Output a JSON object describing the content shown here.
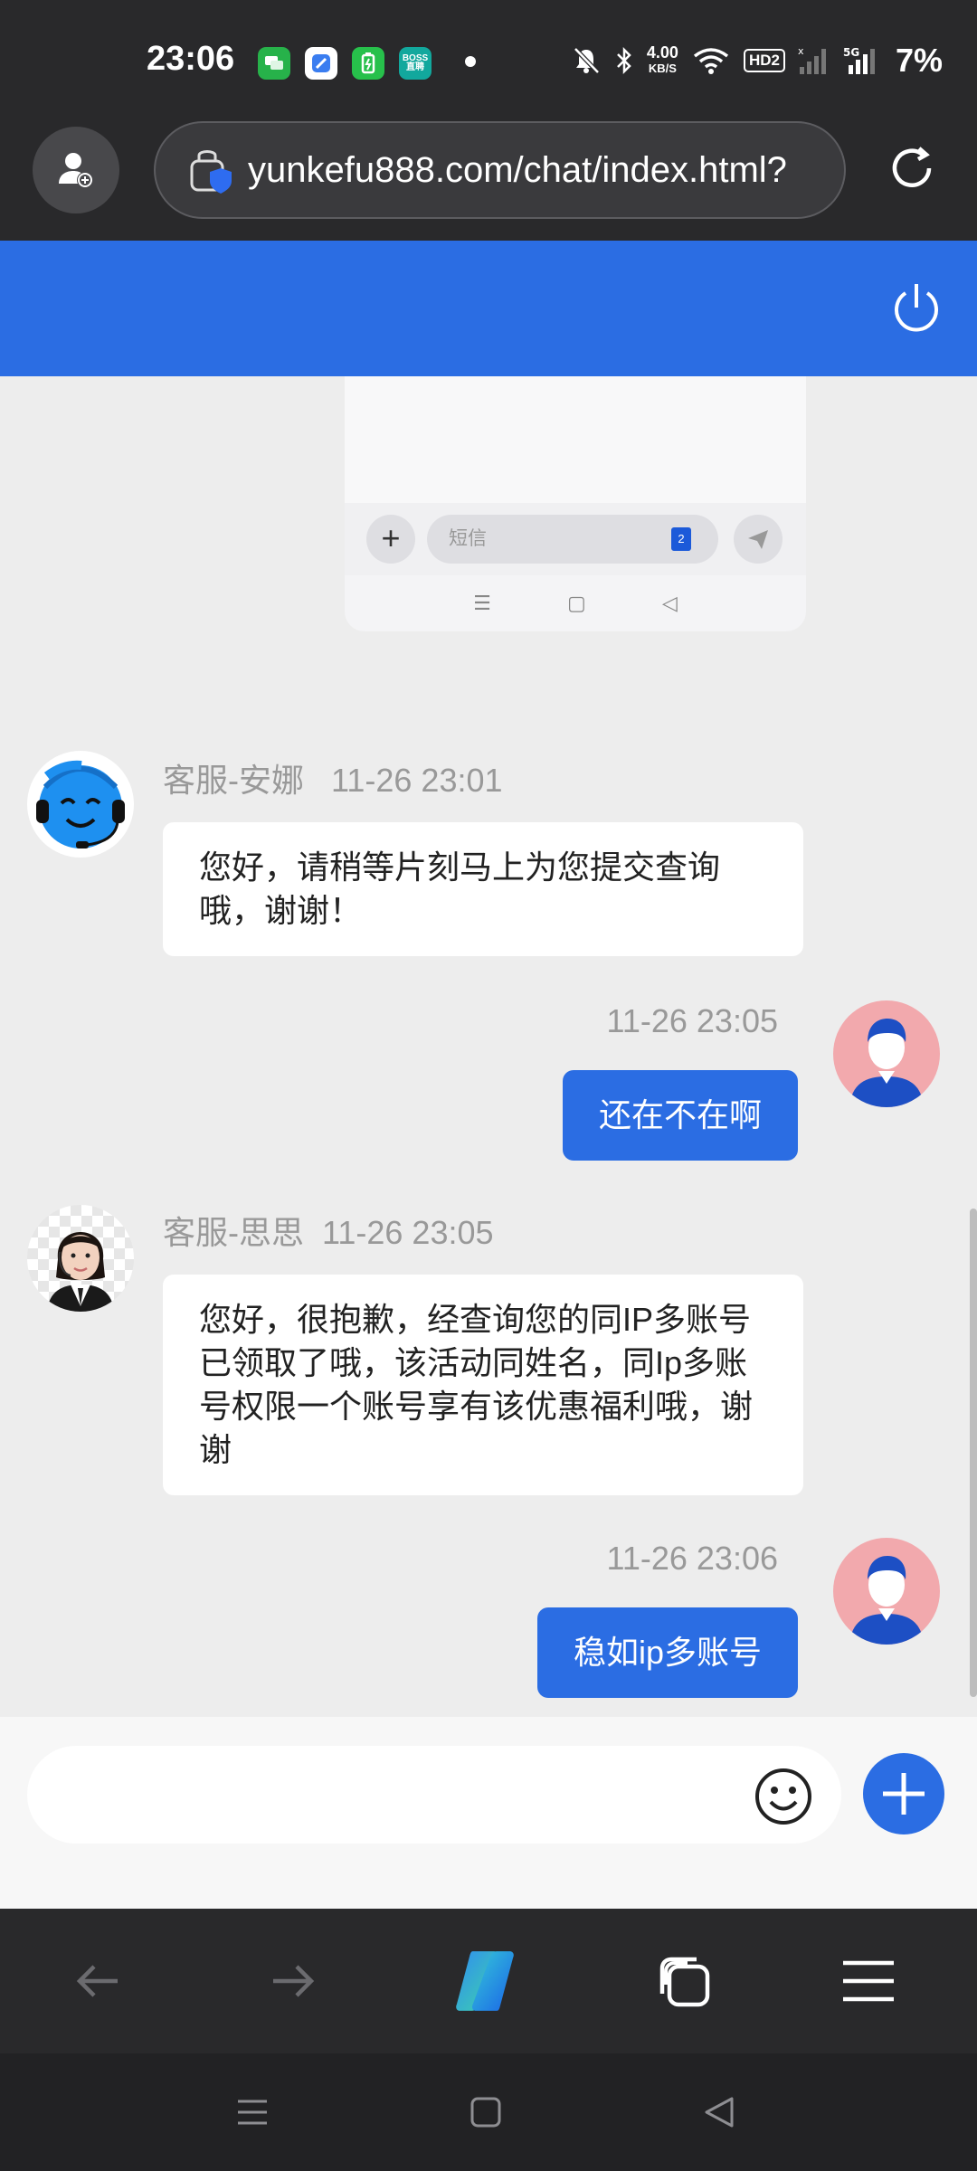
{
  "status_bar": {
    "time": "23:06",
    "net_speed_value": "4.00",
    "net_speed_unit": "KB/S",
    "hd_label": "HD2",
    "network_label": "5G",
    "battery": "7%",
    "app_icons": [
      "messages-icon",
      "browser-icon",
      "battery-app-icon",
      "boss-zhipin-icon"
    ],
    "boss_label_1": "BOSS",
    "boss_label_2": "直聘"
  },
  "browser": {
    "url": "yunkefu888.com/chat/index.html?"
  },
  "chat": {
    "shared_screenshot": {
      "input_placeholder": "短信",
      "badge": "2"
    },
    "messages": [
      {
        "side": "left",
        "sender": "客服-安娜",
        "time": "11-26 23:01",
        "text": "您好，请稍等片刻马上为您提交查询哦，谢谢！",
        "avatar": "bot-headset-avatar"
      },
      {
        "side": "right",
        "time": "11-26 23:05",
        "text": "还在不在啊",
        "avatar": "user-avatar"
      },
      {
        "side": "left",
        "sender": "客服-思思",
        "time": "11-26 23:05",
        "text": "您好，很抱歉，经查询您的同IP多账号已领取了哦，该活动同姓名，同Ip多账号权限一个账号享有该优惠福利哦，谢谢",
        "avatar": "agent-photo-avatar"
      },
      {
        "side": "right",
        "time": "11-26 23:06",
        "text": "稳如ip多账号",
        "avatar": "user-avatar"
      }
    ]
  },
  "input": {
    "placeholder": ""
  },
  "colors": {
    "primary": "#2b6de3",
    "chat_bg": "#ededed",
    "dark_bar": "#29292b",
    "user_avatar_bg": "#f2a9ad"
  }
}
